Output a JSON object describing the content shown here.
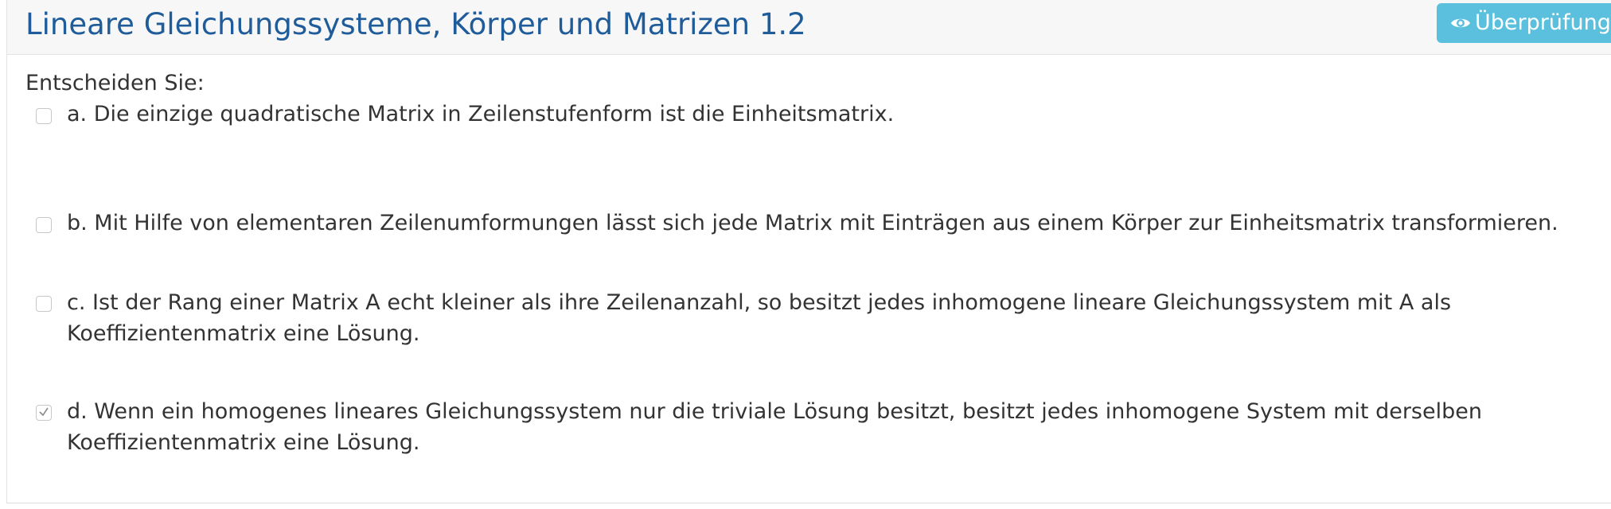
{
  "question": {
    "title": "Lineare Gleichungssysteme, Körper und Matrizen 1.2",
    "check_button_label": "Überprüfung",
    "prompt": "Entscheiden Sie:"
  },
  "options": [
    {
      "label": "a. Die einzige quadratische Matrix in Zeilenstufenform ist die Einheitsmatrix.",
      "checked": false
    },
    {
      "label": "b. Mit Hilfe von elementaren Zeilenumformungen lässt sich jede Matrix mit Einträgen aus einem Körper zur Einheitsmatrix transformieren.",
      "checked": false
    },
    {
      "label": "c. Ist der Rang einer Matrix A echt kleiner als ihre Zeilenanzahl, so besitzt jedes inhomogene lineare Gleichungssystem mit A als Koeffizientenmatrix eine Lösung.",
      "checked": false
    },
    {
      "label": "d. Wenn ein homogenes lineares Gleichungssystem nur die triviale Lösung besitzt, besitzt jedes inhomogene System mit derselben Koeffizientenmatrix eine Lösung.",
      "checked": true
    }
  ],
  "colors": {
    "title": "#1f5c99",
    "check_button": "#5bc0de",
    "header_background": "#f7f7f7"
  },
  "icons": {
    "check_button_icon": "eye-icon",
    "checked_mark": "checkmark-icon"
  }
}
